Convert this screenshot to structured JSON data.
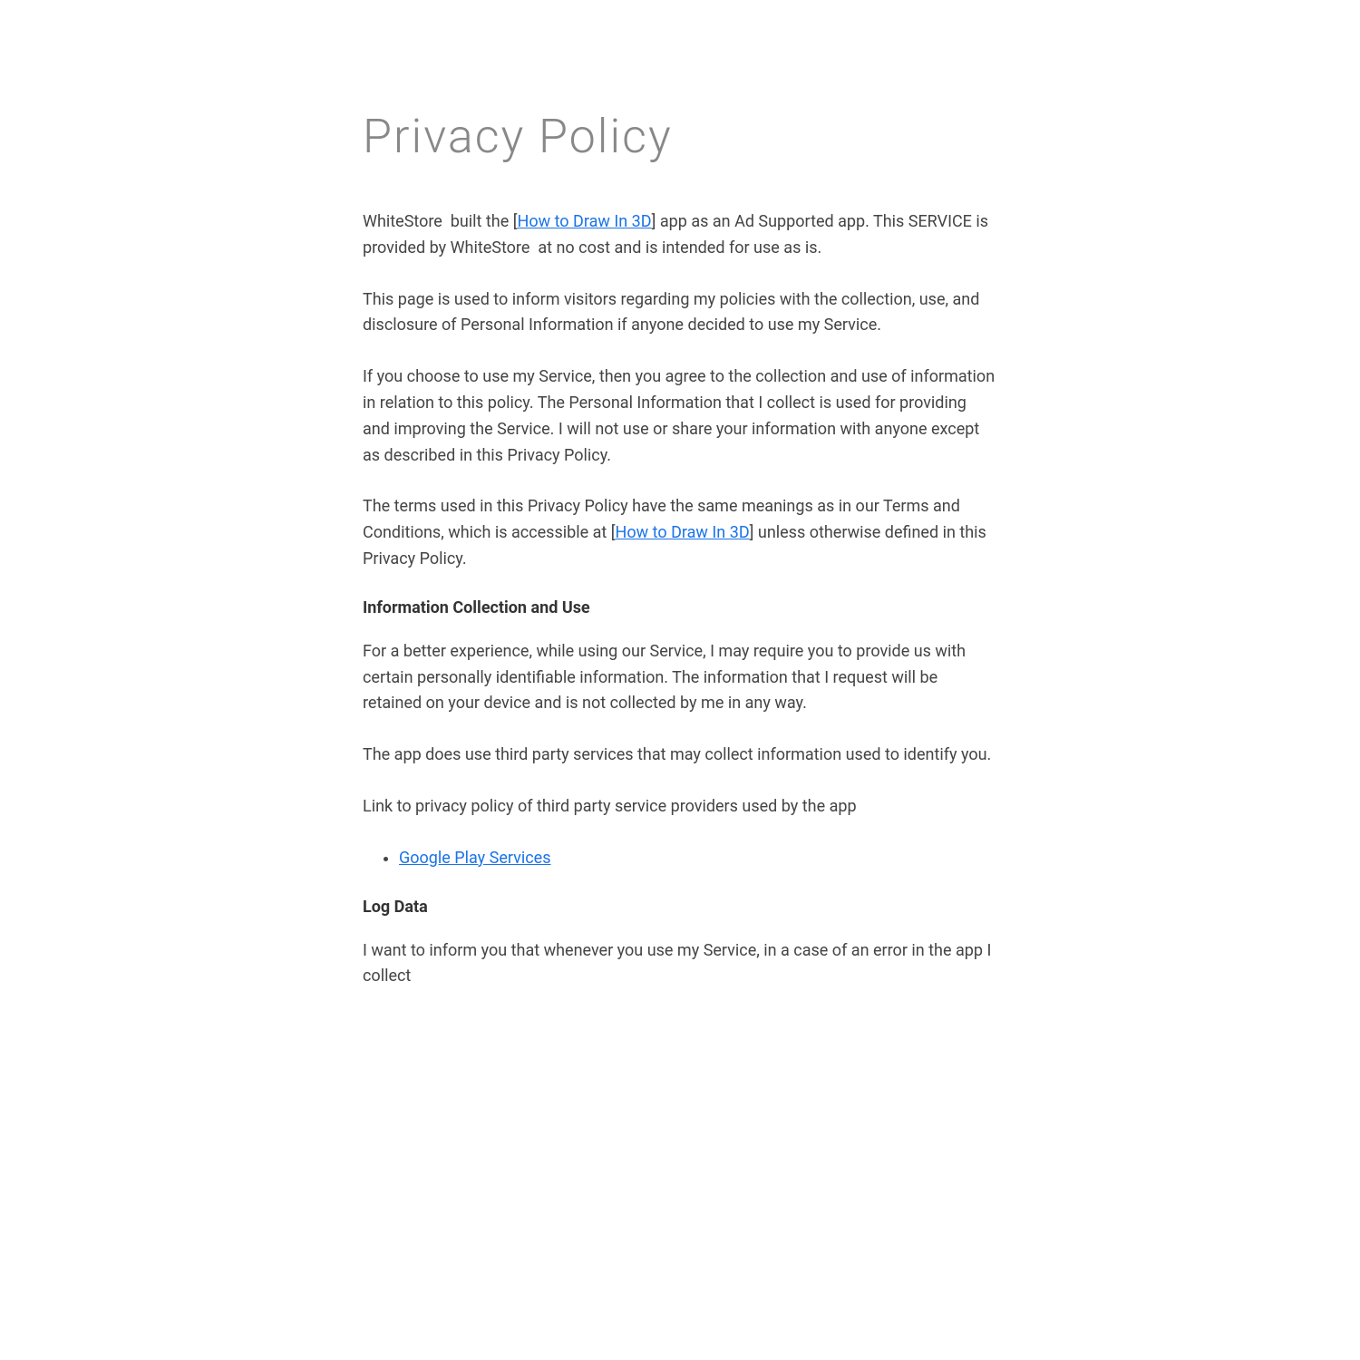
{
  "page": {
    "title": "Privacy Policy",
    "intro_paragraph_1": "WhiteStore  built the [How to Draw In 3D] app as an Ad Supported app. This SERVICE is provided by WhiteStore  at no cost and is intended for use as is.",
    "intro_link_1": "How to Draw In 3D",
    "intro_paragraph_2": "This page is used to inform visitors regarding my policies with the collection, use, and disclosure of Personal Information if anyone decided to use my Service.",
    "intro_paragraph_3": "If you choose to use my Service, then you agree to the collection and use of information in relation to this policy. The Personal Information that I collect is used for providing and improving the Service. I will not use or share your information with anyone except as described in this Privacy Policy.",
    "intro_paragraph_4_pre": "The terms used in this Privacy Policy have the same meanings as in our Terms and Conditions, which is accessible at [",
    "intro_link_2": "How to Draw In 3D",
    "intro_paragraph_4_post": "] unless otherwise defined in this Privacy Policy.",
    "section1_heading": "Information Collection and Use",
    "section1_paragraph_1": "For a better experience, while using our Service, I may require you to provide us with certain personally identifiable information. The information that I request will be retained on your device and is not collected by me in any way.",
    "section1_paragraph_2": "The app does use third party services that may collect information used to identify you.",
    "section1_paragraph_3": "Link to privacy policy of third party service providers used by the app",
    "third_party_services": [
      {
        "label": "Google Play Services",
        "url": "#"
      }
    ],
    "section2_heading": "Log Data",
    "section2_paragraph_1": "I want to inform you that whenever you use my Service, in a case of an error in the app I collect"
  }
}
